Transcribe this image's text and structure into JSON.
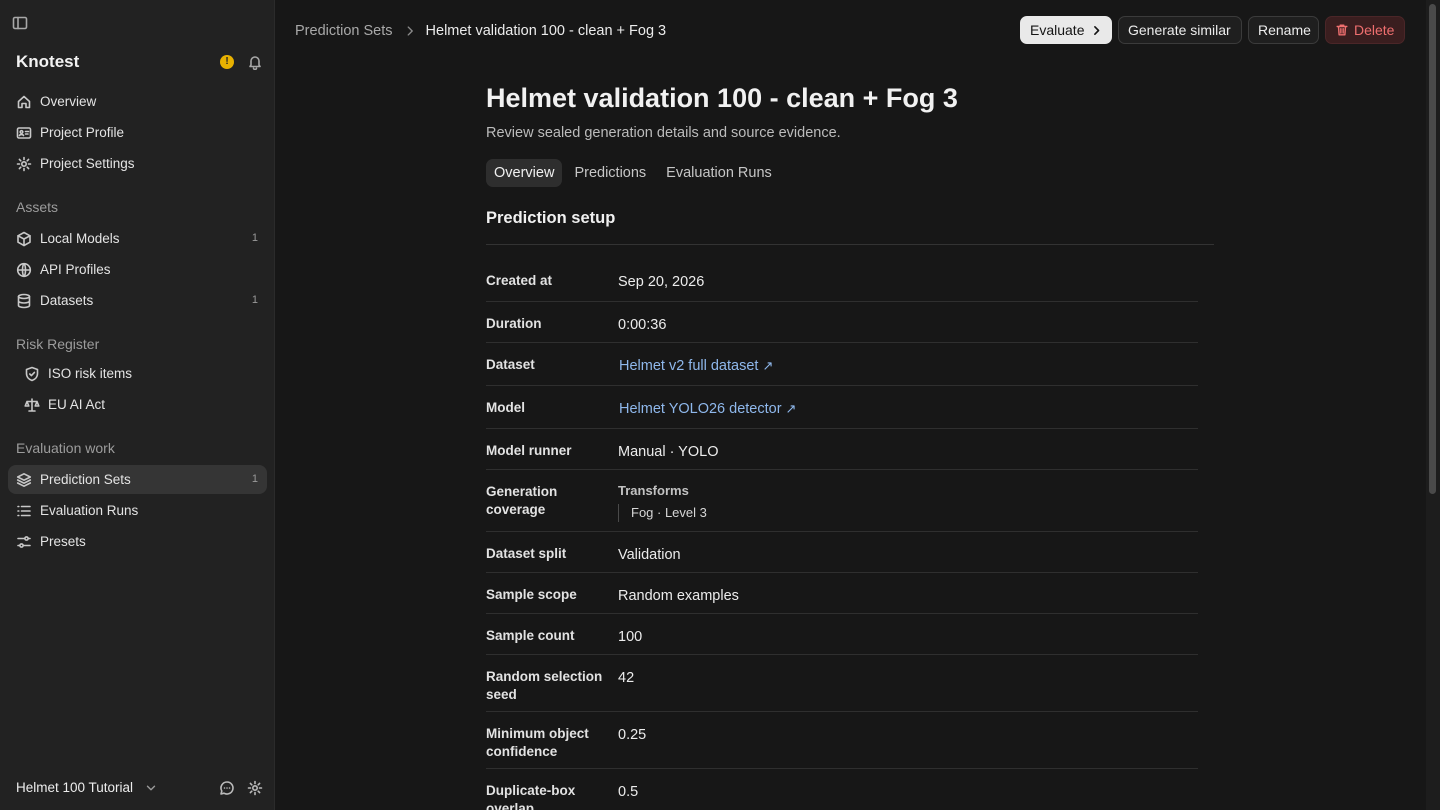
{
  "sidebar": {
    "brand": "Knotest",
    "warning_badge": "!",
    "top_items": [
      {
        "label": "Overview",
        "icon": "home-icon"
      },
      {
        "label": "Project Profile",
        "icon": "id-card-icon"
      },
      {
        "label": "Project Settings",
        "icon": "gear-icon"
      }
    ],
    "assets_label": "Assets",
    "asset_items": [
      {
        "label": "Local Models",
        "count": "1",
        "icon": "cube-icon"
      },
      {
        "label": "API Profiles",
        "count": "",
        "icon": "globe-icon"
      },
      {
        "label": "Datasets",
        "count": "1",
        "icon": "database-icon"
      }
    ],
    "risk_label": "Risk Register",
    "risk_items": [
      {
        "label": "ISO risk items",
        "icon": "shield-icon"
      },
      {
        "label": "EU AI Act",
        "icon": "scale-icon"
      }
    ],
    "eval_label": "Evaluation work",
    "eval_items": [
      {
        "label": "Prediction Sets",
        "count": "1",
        "icon": "layers-icon",
        "active": true
      },
      {
        "label": "Evaluation Runs",
        "count": "",
        "icon": "list-icon"
      },
      {
        "label": "Presets",
        "count": "",
        "icon": "sliders-icon"
      }
    ],
    "project_name": "Helmet 100 Tutorial"
  },
  "header": {
    "breadcrumb_parent": "Prediction Sets",
    "breadcrumb_current": "Helmet validation 100 - clean + Fog 3",
    "evaluate_label": "Evaluate",
    "generate_similar_label": "Generate similar",
    "rename_label": "Rename",
    "delete_label": "Delete"
  },
  "main": {
    "title": "Helmet validation 100 - clean + Fog 3",
    "subtitle": "Review sealed generation details and source evidence.",
    "tabs": [
      "Overview",
      "Predictions",
      "Evaluation Runs"
    ],
    "active_tab": "Overview",
    "section_title": "Prediction setup",
    "fields": {
      "created_at": {
        "label": "Created at",
        "value": "Sep 20, 2026"
      },
      "duration": {
        "label": "Duration",
        "value": "0:00:36"
      },
      "dataset": {
        "label": "Dataset",
        "value": "Helmet v2 full dataset",
        "arrow": "↗"
      },
      "model": {
        "label": "Model",
        "value": "Helmet YOLO26 detector",
        "arrow": "↗"
      },
      "model_runner": {
        "label": "Model runner",
        "value": "Manual · YOLO"
      },
      "generation_coverage": {
        "label": "Generation coverage",
        "heading": "Transforms",
        "item": "Fog · Level 3"
      },
      "dataset_split": {
        "label": "Dataset split",
        "value": "Validation"
      },
      "sample_scope": {
        "label": "Sample scope",
        "value": "Random examples"
      },
      "sample_count": {
        "label": "Sample count",
        "value": "100"
      },
      "random_seed": {
        "label": "Random selection seed",
        "value": "42"
      },
      "min_confidence": {
        "label": "Minimum object confidence",
        "value": "0.25"
      },
      "duplicate_overlap": {
        "label": "Duplicate-box overlap",
        "value": "0.5"
      }
    }
  },
  "colors": {
    "background": "#171717",
    "sidebar": "#222222",
    "link": "#8fb8ec",
    "danger": "#ef6f6f",
    "warning": "#e8b100"
  }
}
